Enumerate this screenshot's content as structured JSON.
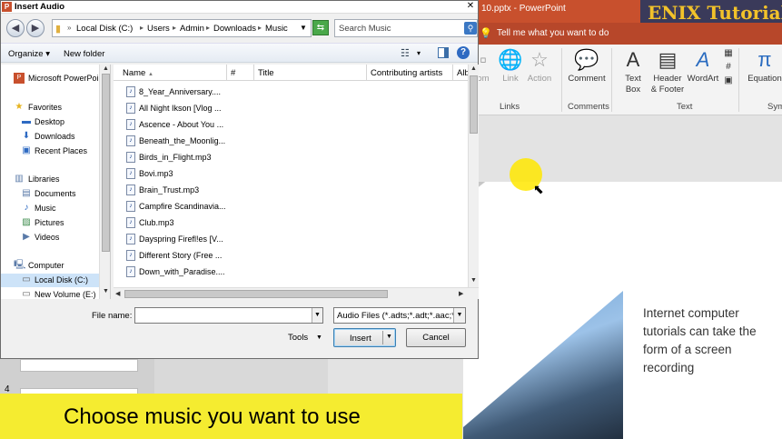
{
  "powerpoint": {
    "title": "10.pptx - PowerPoint",
    "brand": "ENIX Tutorials",
    "tell_me": "Tell me what you want to do",
    "ribbon": {
      "partial_left": "om",
      "link": "Link",
      "action": "Action",
      "links_group": "Links",
      "comment": "Comment",
      "comments_group": "Comments",
      "text_box_1": "Text",
      "text_box_2": "Box",
      "header_footer_1": "Header",
      "header_footer_2": "& Footer",
      "wordart": "WordArt",
      "text_group": "Text",
      "equation": "Equation",
      "symbols_group_partial": "Sym"
    },
    "slide_text": "Internet computer tutorials can take the form of a screen recording",
    "thumb_number": "4"
  },
  "caption": "Choose music you want to use",
  "dialog": {
    "title": "Insert Audio",
    "app_icon_letter": "P",
    "close": "✕",
    "breadcrumbs": [
      "Local Disk (C:)",
      "Users",
      "Admin",
      "Downloads",
      "Music"
    ],
    "search_placeholder": "Search Music",
    "organize": "Organize",
    "new_folder": "New folder",
    "nav": [
      {
        "label": "Microsoft PowerPoint",
        "icon": "powerpoint-icon"
      },
      {
        "label": "Favorites",
        "icon": "star-icon"
      },
      {
        "label": "Desktop",
        "icon": "desktop-icon"
      },
      {
        "label": "Downloads",
        "icon": "downloads-icon"
      },
      {
        "label": "Recent Places",
        "icon": "recent-icon"
      },
      {
        "label": "Libraries",
        "icon": "library-icon"
      },
      {
        "label": "Documents",
        "icon": "documents-icon"
      },
      {
        "label": "Music",
        "icon": "music-icon"
      },
      {
        "label": "Pictures",
        "icon": "pictures-icon"
      },
      {
        "label": "Videos",
        "icon": "videos-icon"
      },
      {
        "label": "Computer",
        "icon": "computer-icon"
      },
      {
        "label": "Local Disk (C:)",
        "icon": "disk-icon"
      },
      {
        "label": "New Volume (E:)",
        "icon": "disk-icon"
      }
    ],
    "columns": [
      "Name",
      "#",
      "Title",
      "Contributing artists",
      "Alb"
    ],
    "files": [
      "8_Year_Anniversary....",
      "All Night Ikson [Vlog ...",
      "Ascence - About You ...",
      "Beneath_the_Moonlig...",
      "Birds_in_Flight.mp3",
      "Bovi.mp3",
      "Brain_Trust.mp3",
      "Campfire Scandinavia...",
      "Club.mp3",
      "Dayspring Firefl!es [V...",
      "Different Story (Free ...",
      "Down_with_Paradise...."
    ],
    "file_name_label": "File name:",
    "file_name_value": "",
    "filter": "Audio Files (*.adts;*.adt;*.aac;*.",
    "tools": "Tools",
    "insert": "Insert",
    "cancel": "Cancel"
  },
  "colors": {
    "pp_orange": "#c8502d",
    "caption_yellow": "#f5ec30",
    "cursor_highlight": "#ffe800"
  }
}
